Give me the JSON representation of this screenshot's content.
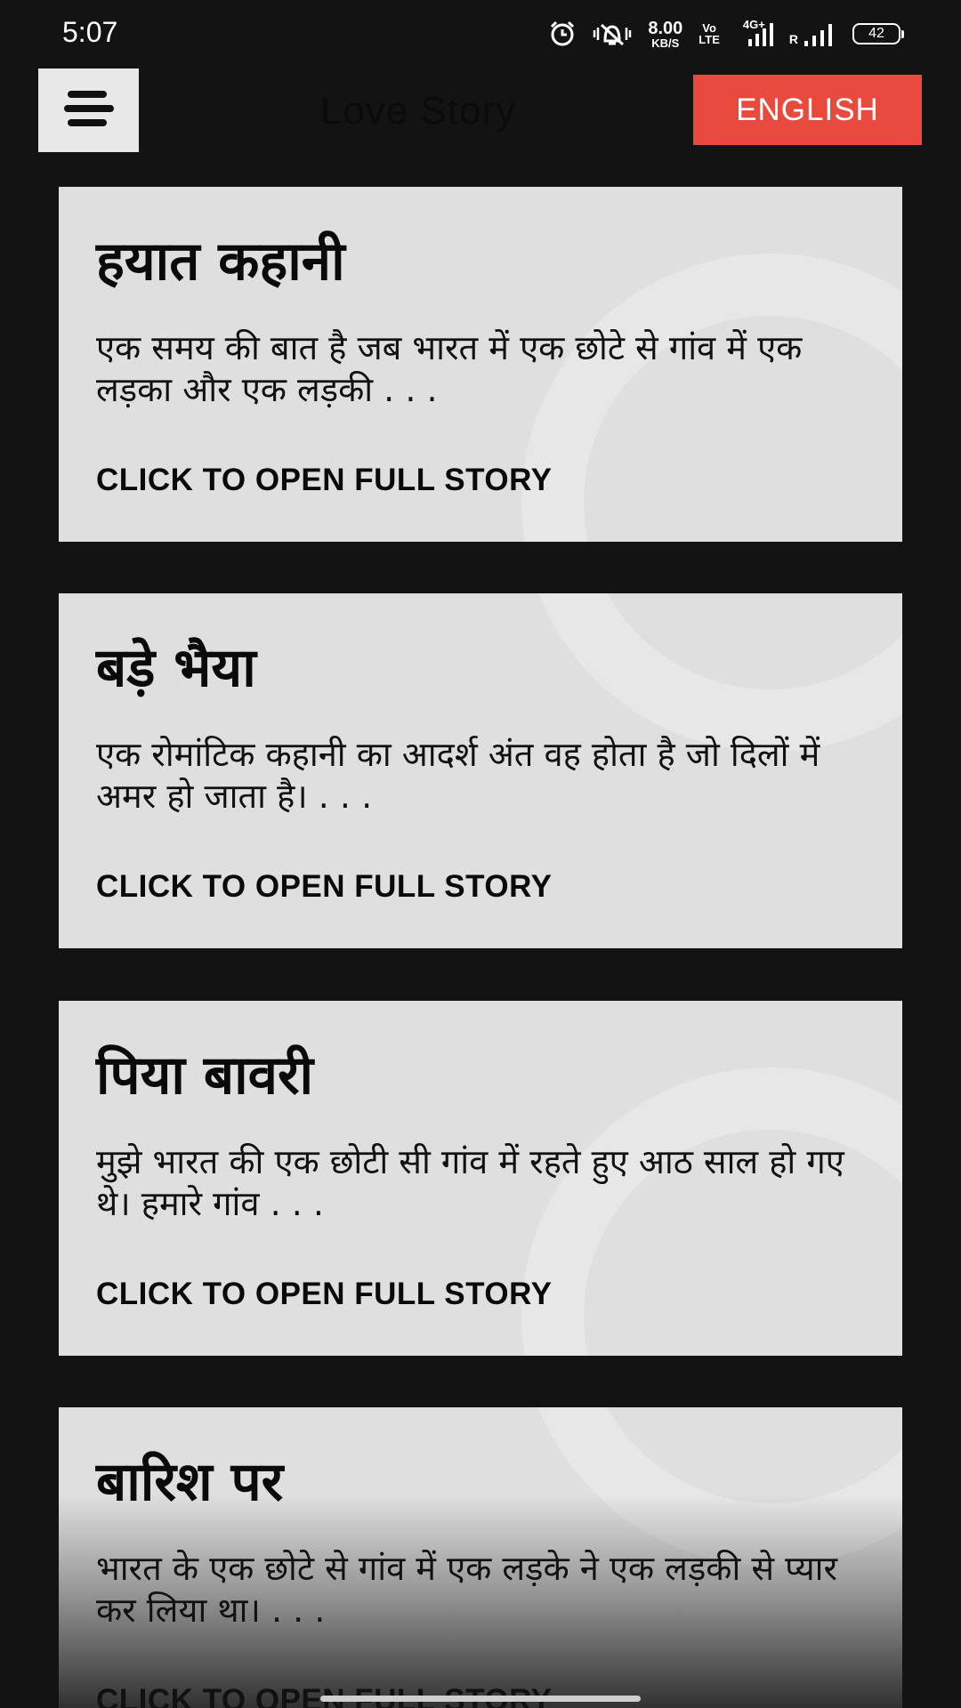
{
  "status_bar": {
    "time": "5:07",
    "net_speed_value": "8.00",
    "net_speed_unit": "KB/S",
    "volte_top": "Vo",
    "volte_bottom": "LTE",
    "network_type": "4G+",
    "roaming": "R",
    "battery": "42",
    "icons": [
      "alarm-icon",
      "vibrate-silent-icon",
      "signal-icon",
      "signal-icon"
    ]
  },
  "app_bar": {
    "menu_icon": "hamburger-menu-icon",
    "title": "Love Story",
    "language_button": "ENGLISH",
    "language_button_color": "#e84a3d"
  },
  "stories": [
    {
      "title": "हयात कहानी",
      "excerpt": "एक समय की बात है जब भारत में एक छोटे से गांव में एक लड़का और एक लड़की . . .",
      "cta": "CLICK TO OPEN FULL STORY"
    },
    {
      "title": "बड़े भैया",
      "excerpt": "एक रोमांटिक कहानी का आदर्श अंत वह होता है जो दिलों में अमर हो जाता है। . . .",
      "cta": "CLICK TO OPEN FULL STORY"
    },
    {
      "title": "पिया बावरी",
      "excerpt": "मुझे भारत की एक छोटी सी गांव में रहते हुए आठ साल हो गए थे। हमारे गांव . . .",
      "cta": "CLICK TO OPEN FULL STORY"
    },
    {
      "title": "बारिश पर",
      "excerpt": "भारत के एक छोटे से गांव में एक लड़के ने एक लड़की से प्यार कर लिया था। . . .",
      "cta": "CLICK TO OPEN FULL STORY"
    }
  ],
  "colors": {
    "background": "#131313",
    "card": "#dfdfdf",
    "menu_button": "#e8e8e8"
  }
}
